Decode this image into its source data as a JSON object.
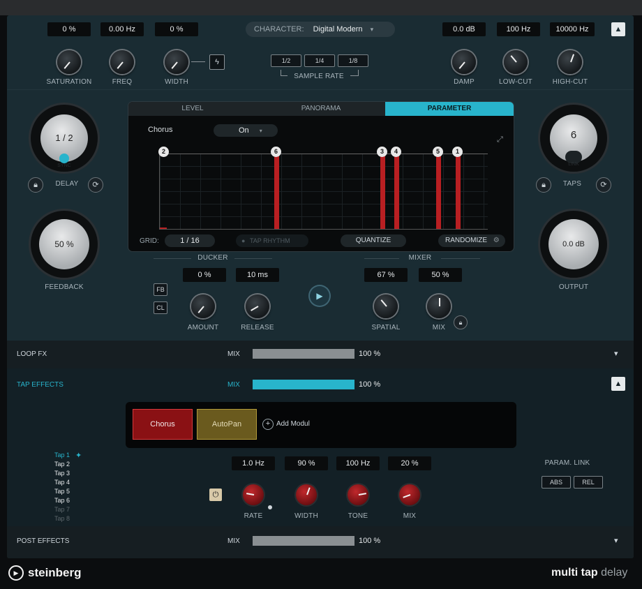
{
  "top": {
    "values": [
      "0 %",
      "0.00 Hz",
      "0 %",
      "0.0 dB",
      "100 Hz",
      "10000 Hz"
    ],
    "knob_labels": [
      "SATURATION",
      "FREQ",
      "WIDTH",
      "DAMP",
      "LOW-CUT",
      "HIGH-CUT"
    ],
    "character_label": "CHARACTER:",
    "character_value": "Digital Modern",
    "sample_rate_buttons": [
      "1/2",
      "1/4",
      "1/8"
    ],
    "sample_rate_label": "SAMPLE RATE"
  },
  "delay": {
    "value": "1 / 2",
    "sync": "SYNC",
    "label": "DELAY"
  },
  "feedback": {
    "value": "50 %",
    "label": "FEEDBACK"
  },
  "taps": {
    "value": "6",
    "link": "LINK",
    "label": "TAPS"
  },
  "output": {
    "value": "0.0 dB",
    "label": "OUTPUT"
  },
  "editor": {
    "tabs": [
      "LEVEL",
      "PANORAMA",
      "PARAMETER"
    ],
    "param_name": "Chorus",
    "param_state": "On",
    "grid_label": "GRID:",
    "grid_value": "1 / 16",
    "tap_rhythm": "TAP RHYTHM",
    "quantize": "QUANTIZE",
    "randomize": "RANDOMIZE",
    "tap_numbers": [
      "2",
      "6",
      "3",
      "4",
      "5",
      "1"
    ]
  },
  "ducker": {
    "title": "DUCKER",
    "values": [
      "0 %",
      "10 ms"
    ],
    "labels": [
      "AMOUNT",
      "RELEASE"
    ],
    "fb": "FB",
    "cl": "CL"
  },
  "mixer": {
    "title": "MIXER",
    "values": [
      "67 %",
      "50 %"
    ],
    "labels": [
      "SPATIAL",
      "MIX"
    ]
  },
  "loopfx": {
    "label": "LOOP FX",
    "mix": "MIX",
    "value": "100 %",
    "level": 1.0
  },
  "tapfx": {
    "label": "TAP EFFECTS",
    "mix": "MIX",
    "value": "100 %",
    "level": 1.0,
    "modules": [
      "Chorus",
      "AutoPan"
    ],
    "add_module": "Add Modul",
    "taps": [
      "Tap 1",
      "Tap 2",
      "Tap 3",
      "Tap 4",
      "Tap 5",
      "Tap 6",
      "Tap 7",
      "Tap 8"
    ],
    "values": [
      "1.0 Hz",
      "90 %",
      "100 Hz",
      "20 %"
    ],
    "knob_labels": [
      "RATE",
      "WIDTH",
      "TONE",
      "MIX"
    ],
    "param_link": "PARAM. LINK",
    "abs": "ABS",
    "rel": "REL"
  },
  "postfx": {
    "label": "POST EFFECTS",
    "mix": "MIX",
    "value": "100 %",
    "level": 1.0
  },
  "footer": {
    "brand": "steinberg",
    "product_a": "multi tap",
    "product_b": "delay"
  },
  "colors": {
    "accent": "#28b4cc",
    "tap_red": "#b81f22",
    "module_red": "#8a1114",
    "module_olive": "#6a5a1e"
  }
}
